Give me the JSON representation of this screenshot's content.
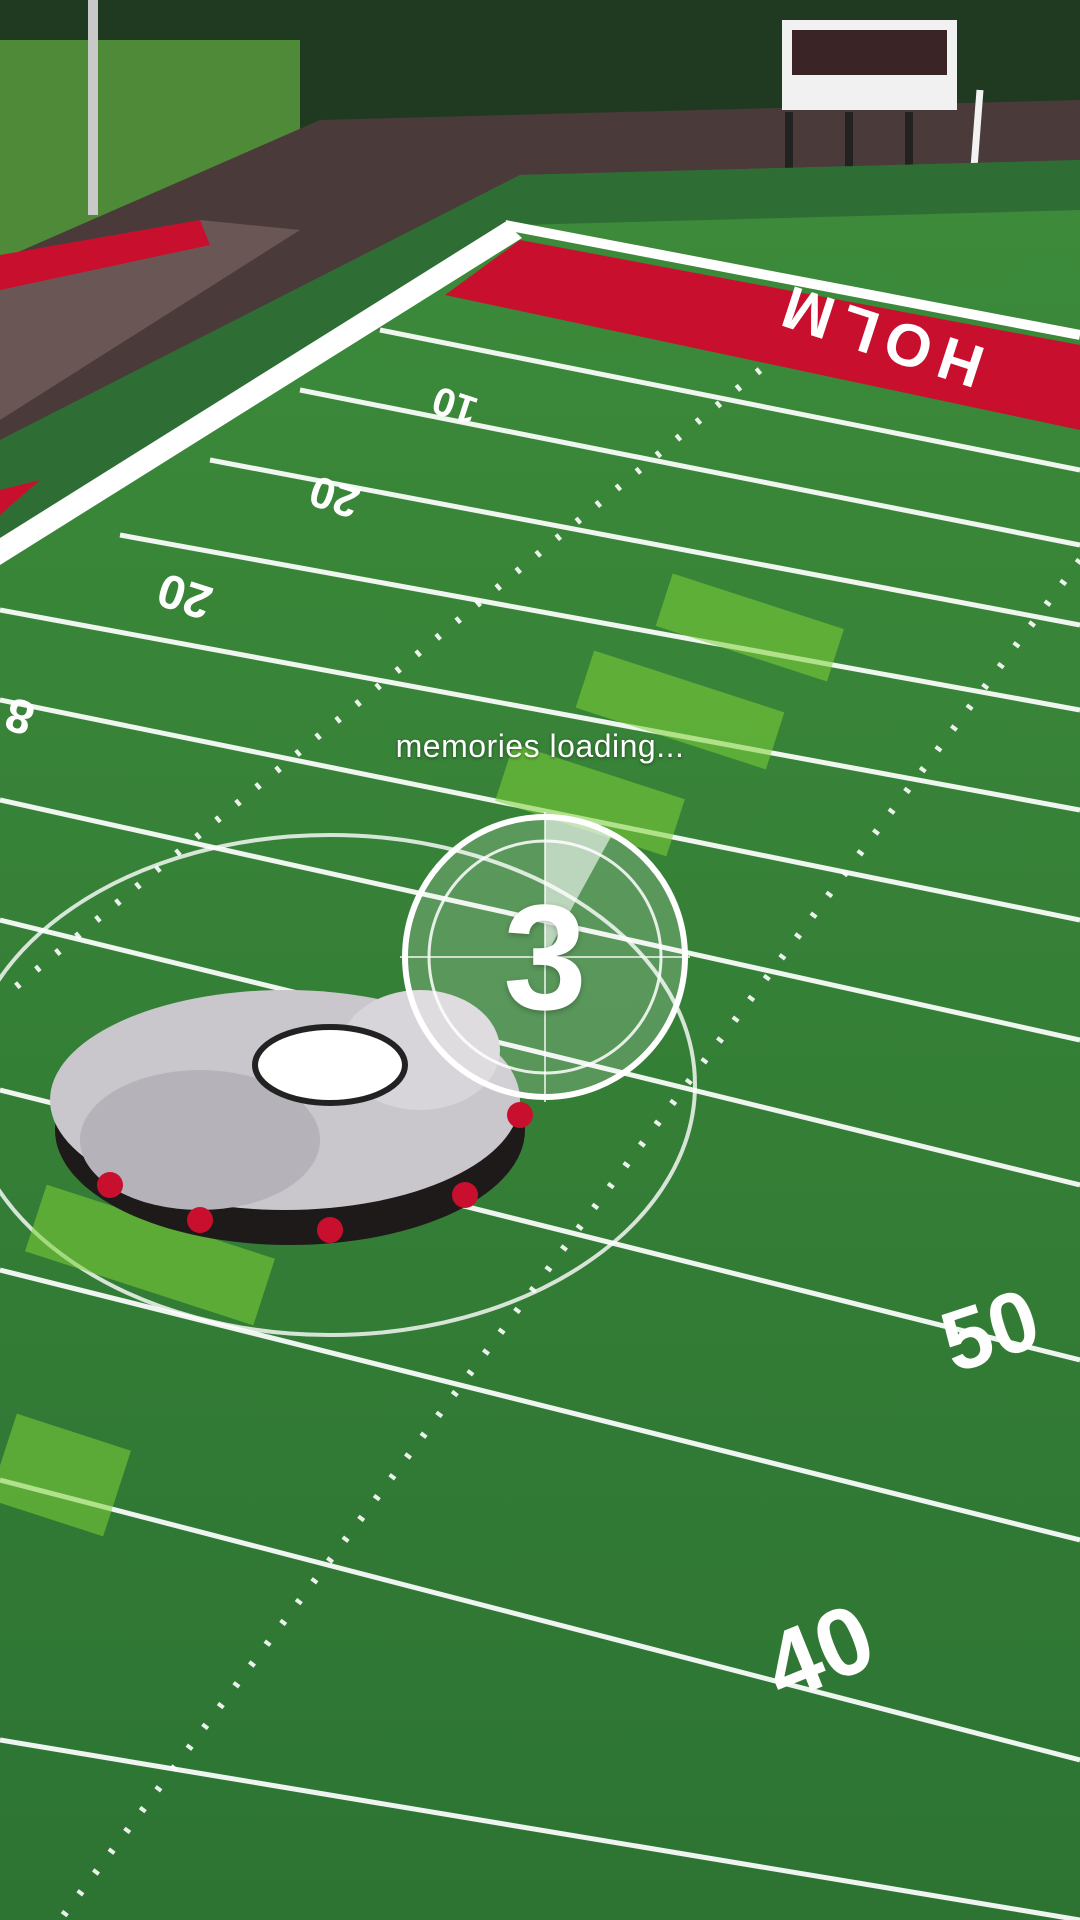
{
  "video": {
    "status_text": "memories loading...",
    "countdown_number": "3",
    "countdown_progress": 0.08
  },
  "scene": {
    "endzone_text": "HOLM",
    "yard_numbers": [
      "10",
      "20",
      "20",
      "8",
      "50",
      "40"
    ],
    "colors": {
      "turf": "#2f7a34",
      "turf_light": "#3f8f3a",
      "endzone": "#c8102e",
      "line": "#ffffff",
      "track": "#4a3a3a",
      "trees": "#1f3a20",
      "lettering": "#7fd13a"
    }
  }
}
